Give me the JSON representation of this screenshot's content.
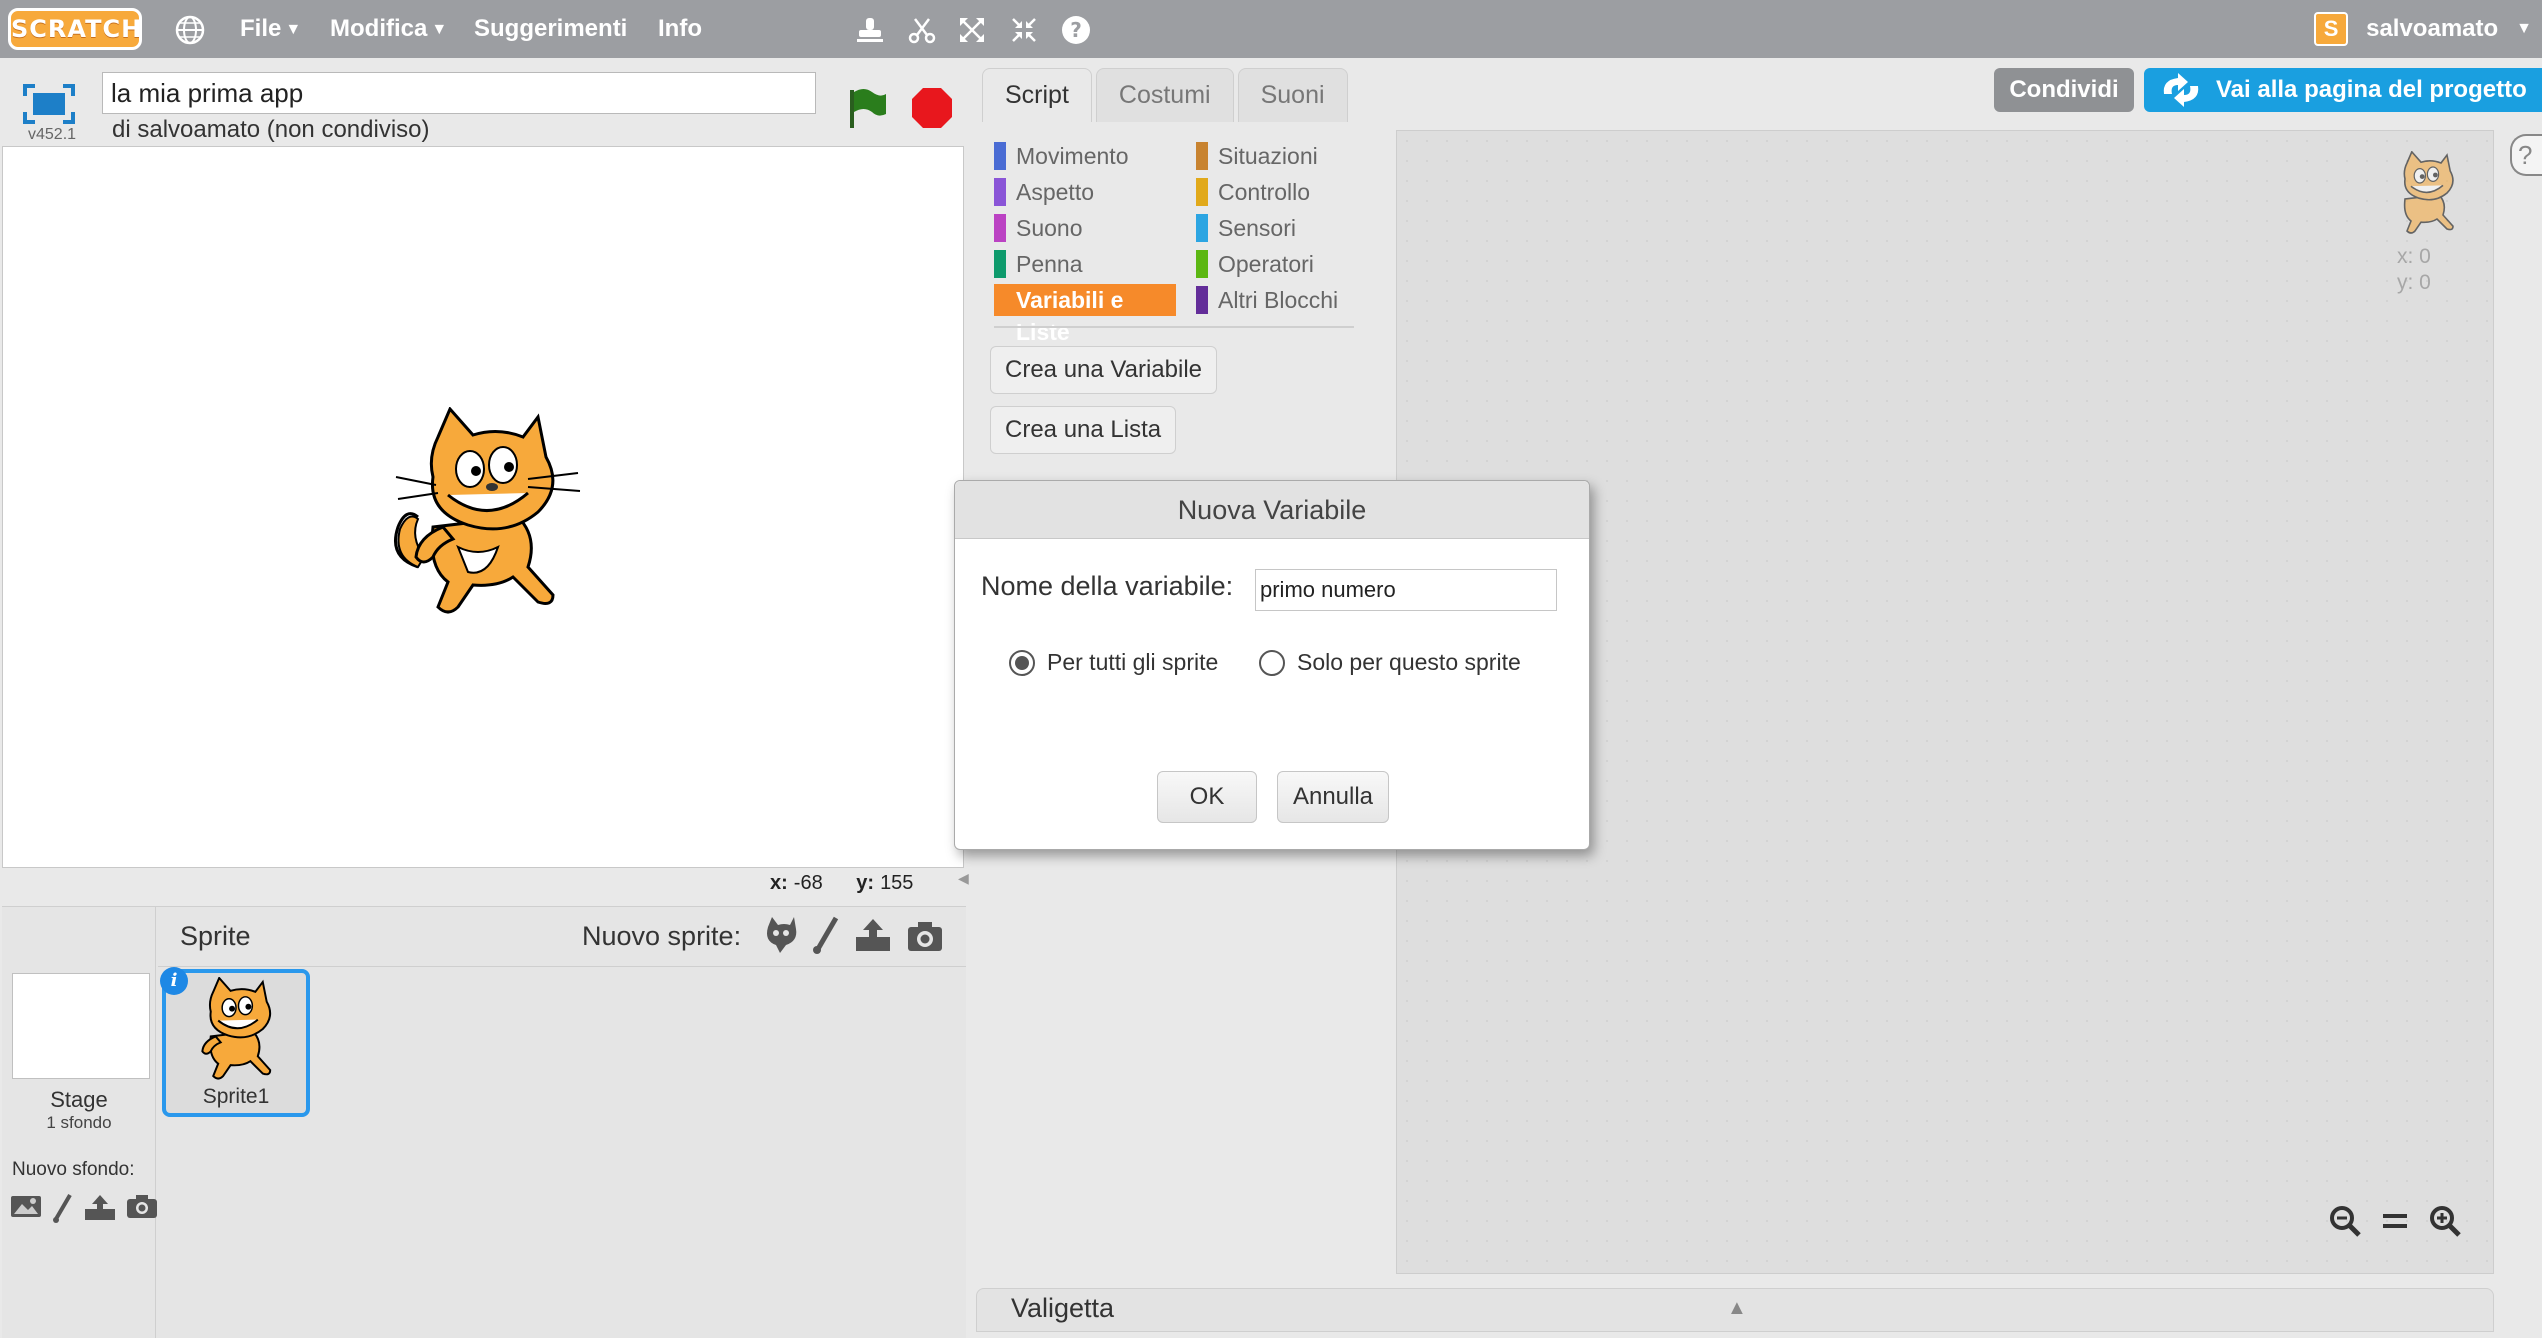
{
  "topbar": {
    "logo_text": "SCRATCH",
    "menu": {
      "file": "File",
      "edit": "Modifica",
      "tips": "Suggerimenti",
      "about": "Info"
    },
    "user": {
      "avatar_text": "S",
      "username": "salvoamato"
    }
  },
  "stage_header": {
    "version": "v452.1",
    "project_title": "la mia prima app",
    "owner_text": "di salvoamato (non condiviso)"
  },
  "stage": {
    "coords": {
      "x_label": "x:",
      "x_value": "-68",
      "y_label": "y:",
      "y_value": "155"
    }
  },
  "sprite_pane": {
    "stage_label": "Stage",
    "stage_backdrops": "1 sfondo",
    "new_backdrop_label": "Nuovo sfondo:",
    "sprites_header": "Sprite",
    "new_sprite_label": "Nuovo sprite:",
    "sprites": [
      {
        "name": "Sprite1",
        "info_badge": "i"
      }
    ]
  },
  "tabs": [
    "Script",
    "Costumi",
    "Suoni"
  ],
  "palette": {
    "categories_left": [
      {
        "label": "Movimento",
        "color": "#4a6cd4"
      },
      {
        "label": "Aspetto",
        "color": "#8a55d7"
      },
      {
        "label": "Suono",
        "color": "#bb42c3"
      },
      {
        "label": "Penna",
        "color": "#0e9a6c"
      },
      {
        "label": "Variabili e Liste",
        "color": "#ee7d16"
      }
    ],
    "categories_right": [
      {
        "label": "Situazioni",
        "color": "#c88330"
      },
      {
        "label": "Controllo",
        "color": "#e1a91a"
      },
      {
        "label": "Sensori",
        "color": "#2ca5e2"
      },
      {
        "label": "Operatori",
        "color": "#5cb712"
      },
      {
        "label": "Altri Blocchi",
        "color": "#632d99"
      }
    ],
    "selected_category": "Variabili e Liste",
    "buttons": {
      "make_variable": "Crea una Variabile",
      "make_list": "Crea una Lista"
    }
  },
  "toolbar_right": {
    "share": "Condividi",
    "project_page": "Vai alla pagina del progetto"
  },
  "script_area": {
    "sprite_x": "x: 0",
    "sprite_y": "y: 0",
    "help": "?"
  },
  "backpack": {
    "label": "Valigetta"
  },
  "dialog": {
    "title": "Nuova Variabile",
    "name_label": "Nome della variabile:",
    "name_value": "primo numero",
    "options": [
      {
        "label": "Per tutti gli sprite",
        "checked": true
      },
      {
        "label": "Solo per questo sprite",
        "checked": false
      }
    ],
    "ok": "OK",
    "cancel": "Annulla"
  },
  "colors": {
    "topbar": "#9c9ea2",
    "accent_blue": "#1a9fe0",
    "variables_orange": "#f68a2a",
    "stop_red": "#e8171d",
    "flag_green": "#2a7d1c"
  }
}
